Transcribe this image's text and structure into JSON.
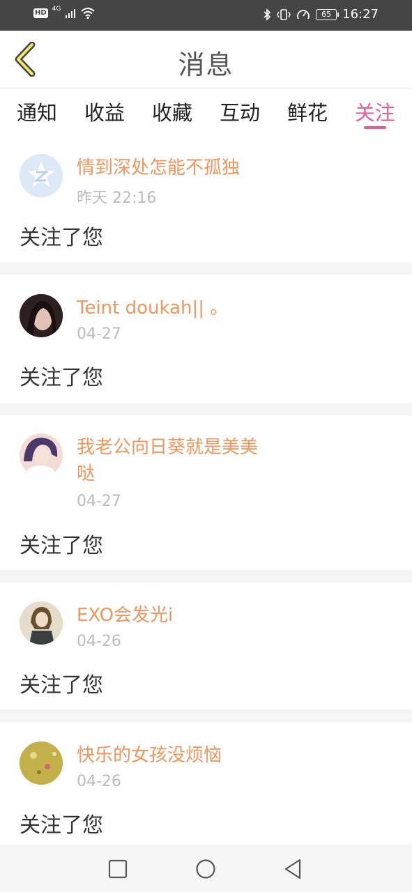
{
  "status_bar": {
    "hd": "HD",
    "network": "4G",
    "battery": "65",
    "time": "16:27"
  },
  "header": {
    "title": "消息"
  },
  "tabs": [
    {
      "label": "通知",
      "active": false
    },
    {
      "label": "收益",
      "active": false
    },
    {
      "label": "收藏",
      "active": false
    },
    {
      "label": "互动",
      "active": false
    },
    {
      "label": "鲜花",
      "active": false
    },
    {
      "label": "关注",
      "active": true
    }
  ],
  "messages": [
    {
      "name": "情到深处怎能不孤独",
      "date": "昨天 22:16",
      "action": "关注了您",
      "avatar": "default-avatar-icon"
    },
    {
      "name": "Teint doukah|| 。",
      "date": "04-27",
      "action": "关注了您",
      "avatar": "user-avatar"
    },
    {
      "name": "我老公向日葵就是美美哒",
      "date": "04-27",
      "action": "关注了您",
      "avatar": "user-avatar"
    },
    {
      "name": "EXO会发光i",
      "date": "04-26",
      "action": "关注了您",
      "avatar": "user-avatar"
    },
    {
      "name": "快乐的女孩没烦恼",
      "date": "04-26",
      "action": "关注了您",
      "avatar": "user-avatar"
    }
  ],
  "colors": {
    "accent": "#e25d9b",
    "username": "#f0955c",
    "statusbar": "#454545"
  }
}
